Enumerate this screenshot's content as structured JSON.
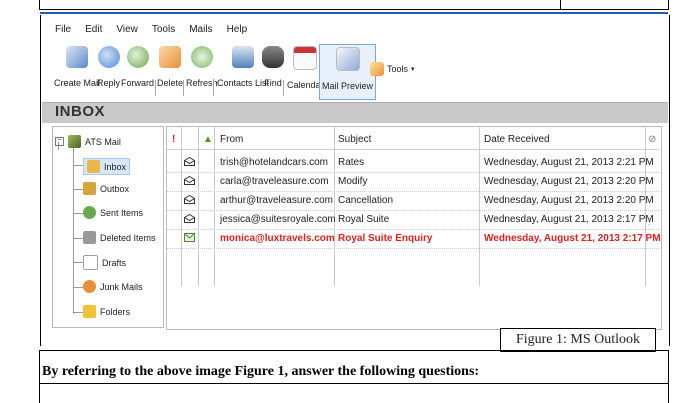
{
  "menu": [
    "File",
    "Edit",
    "View",
    "Tools",
    "Mails",
    "Help"
  ],
  "toolbar": [
    {
      "label": "Create Mail",
      "icon": "create-mail-icon",
      "color": "#5a89c8"
    },
    {
      "label": "Reply",
      "icon": "reply-icon",
      "color": "#4c8bd6"
    },
    {
      "label": "Forward",
      "icon": "forward-icon",
      "color": "#6aa84f"
    },
    {
      "label": "Delete",
      "icon": "delete-icon",
      "color": "#e69138"
    },
    {
      "label": "Refresh",
      "icon": "refresh-icon",
      "color": "#7bb661"
    },
    {
      "label": "Contacts List",
      "icon": "contacts-icon",
      "color": "#4f81bd"
    },
    {
      "label": "Find",
      "icon": "binoculars-icon",
      "color": "#555555"
    },
    {
      "label": "Calendar",
      "icon": "calendar-icon",
      "color": "#cc3333"
    },
    {
      "label": "Mail Preview",
      "icon": "mail-preview-icon",
      "color": "#8faadc"
    }
  ],
  "tools_label": "Tools",
  "folder_title": "INBOX",
  "tree": {
    "root": "ATS Mail",
    "items": [
      {
        "label": "Inbox",
        "icon": "inbox-icon",
        "color": "#e8b84a",
        "selected": true
      },
      {
        "label": "Outbox",
        "icon": "outbox-icon",
        "color": "#d9a53a"
      },
      {
        "label": "Sent Items",
        "icon": "sent-items-icon",
        "color": "#6aa84f"
      },
      {
        "label": "Deleted Items",
        "icon": "deleted-items-icon",
        "color": "#999999"
      },
      {
        "label": "Drafts",
        "icon": "drafts-icon",
        "color": "#a0a0a0"
      },
      {
        "label": "Junk Mails",
        "icon": "junk-mail-icon",
        "color": "#e69138"
      },
      {
        "label": "Folders",
        "icon": "folders-icon",
        "color": "#f1c232"
      }
    ]
  },
  "columns": {
    "from": "From",
    "subject": "Subject",
    "date": "Date Received"
  },
  "messages": [
    {
      "from": "trish@hotelandcars.com",
      "subject": "Rates",
      "date": "Wednesday, August 21, 2013 2:21 PM",
      "unread": false
    },
    {
      "from": "carla@traveleasure.com",
      "subject": "Modify",
      "date": "Wednesday, August 21, 2013 2:20 PM",
      "unread": false
    },
    {
      "from": "arthur@traveleasure.com",
      "subject": "Cancellation",
      "date": "Wednesday, August 21, 2013 2:20 PM",
      "unread": false
    },
    {
      "from": "jessica@suitesroyale.com",
      "subject": "Royal Suite",
      "date": "Wednesday, August 21, 2013 2:17 PM",
      "unread": false
    },
    {
      "from": "monica@luxtravels.com",
      "subject": "Royal Suite Enquiry",
      "date": "Wednesday, August 21, 2013 2:17 PM",
      "unread": true
    }
  ],
  "caption": "Figure 1: MS Outlook",
  "question": "By referring to the above image Figure 1, answer the following questions:",
  "colors": {
    "accent": "#1f5fb3",
    "unread": "#e0201f",
    "inbox_bar": "#c9c9c9"
  }
}
